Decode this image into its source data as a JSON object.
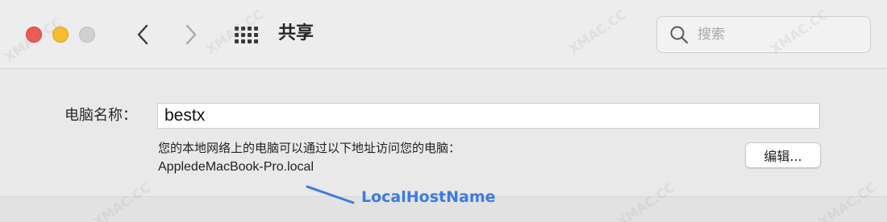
{
  "window": {
    "title": "共享"
  },
  "toolbar": {
    "back_icon": "chevron-left-icon",
    "forward_icon": "chevron-right-icon",
    "grid_icon": "grid-icon",
    "search": {
      "icon": "search-icon",
      "placeholder": "搜索",
      "value": ""
    }
  },
  "computer_name": {
    "label": "电脑名称：",
    "value": "bestx",
    "description": "您的本地网络上的电脑可以通过以下地址访问您的电脑：",
    "hostname": "AppledeMacBook-Pro.local",
    "edit_label": "编辑..."
  },
  "annotation": {
    "text": "LocalHostName",
    "color": "#3d7be0"
  },
  "watermark": {
    "text": "XMAC.CC"
  },
  "colors": {
    "close": "#ee5a52",
    "minimize": "#f5bd2f",
    "zoom_disabled": "#d0d0d0"
  }
}
